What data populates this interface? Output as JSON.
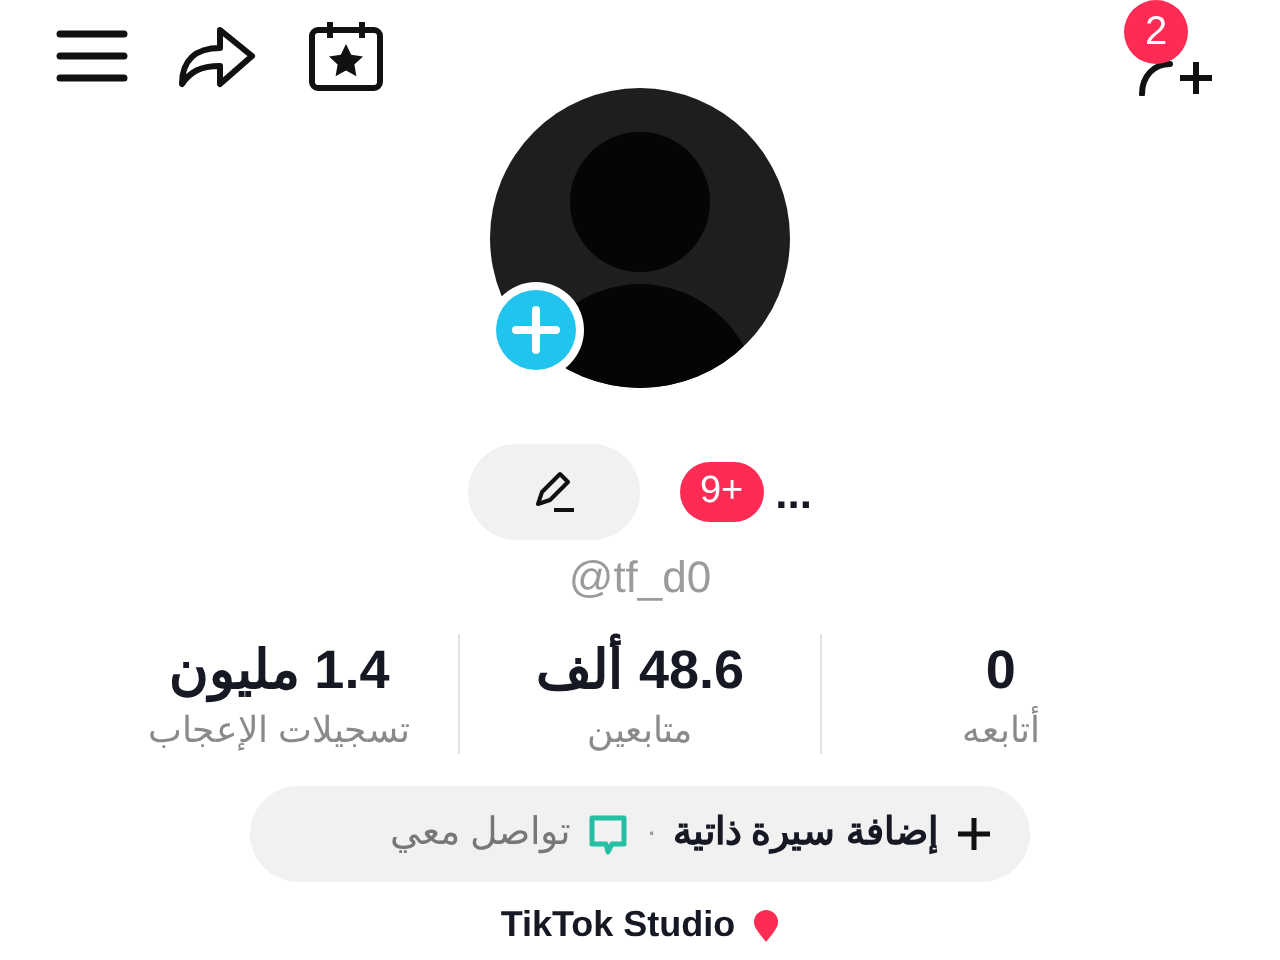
{
  "top_bar": {
    "follow_requests_badge": "2"
  },
  "profile": {
    "name": "...",
    "notifications_badge": "9+",
    "handle": "@tf_d0"
  },
  "stats": [
    {
      "value": "0",
      "label": "أتابعه"
    },
    {
      "value": "48.6 ألف",
      "label": "متابعين"
    },
    {
      "value": "1.4 مليون",
      "label": "تسجيلات الإعجاب"
    }
  ],
  "bio_bar": {
    "add_bio": "إضافة سيرة ذاتية",
    "separator": "·",
    "contact": "تواصل معي"
  },
  "studio_link": "TikTok Studio"
}
